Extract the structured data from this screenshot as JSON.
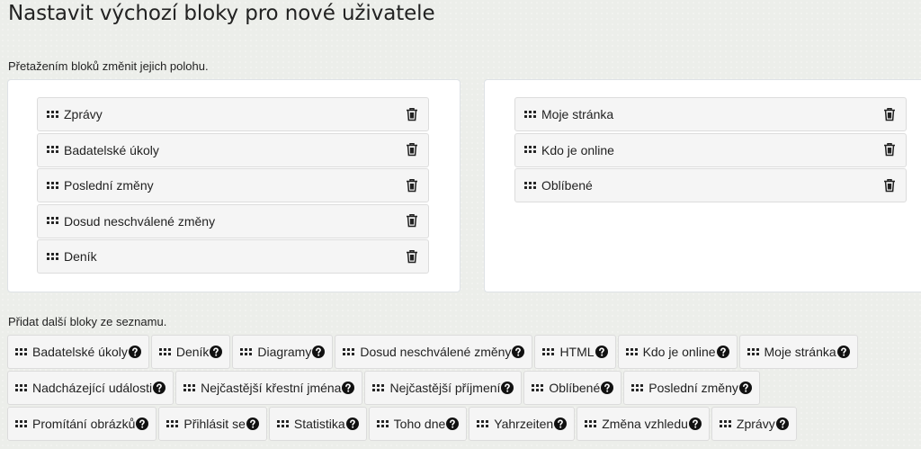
{
  "page": {
    "title": "Nastavit výchozí bloky pro nové uživatele",
    "intro": "Přetažením bloků změnit jejich polohu.",
    "add_label": "Přidat další bloky ze seznamu."
  },
  "main_blocks": [
    {
      "label": "Zprávy"
    },
    {
      "label": "Badatelské úkoly"
    },
    {
      "label": "Poslední změny"
    },
    {
      "label": "Dosud neschválené změny"
    },
    {
      "label": "Deník"
    }
  ],
  "side_blocks": [
    {
      "label": "Moje stránka"
    },
    {
      "label": "Kdo je online"
    },
    {
      "label": "Oblíbené"
    }
  ],
  "available_rows": [
    [
      {
        "label": "Badatelské úkoly"
      },
      {
        "label": "Deník"
      },
      {
        "label": "Diagramy"
      },
      {
        "label": "Dosud neschválené změny"
      },
      {
        "label": "HTML"
      },
      {
        "label": "Kdo je online"
      },
      {
        "label": "Moje stránka"
      }
    ],
    [
      {
        "label": "Nadcházející události"
      },
      {
        "label": "Nejčastější křestní jména"
      },
      {
        "label": "Nejčastější příjmení"
      },
      {
        "label": "Oblíbené"
      },
      {
        "label": "Poslední změny"
      }
    ],
    [
      {
        "label": "Promítání obrázků"
      },
      {
        "label": "Přihlásit se"
      },
      {
        "label": "Statistika"
      },
      {
        "label": "Toho dne"
      },
      {
        "label": "Yahrzeiten"
      },
      {
        "label": "Změna vzhledu"
      },
      {
        "label": "Zprávy"
      }
    ]
  ],
  "icons": {
    "drag": "grip-icon",
    "delete": "trash-icon",
    "help": "help-icon"
  },
  "colors": {
    "background": "#eceeea",
    "block": "#f5f5f5",
    "border": "#dcdcdc"
  }
}
